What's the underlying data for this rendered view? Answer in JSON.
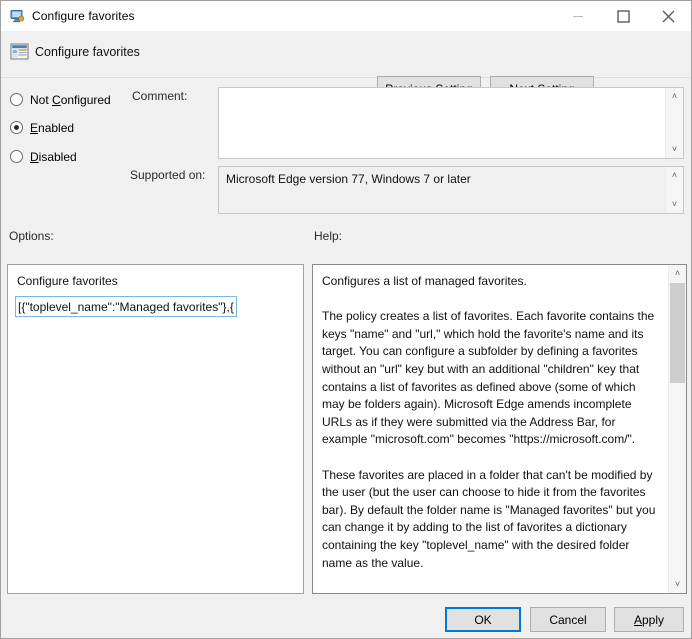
{
  "window": {
    "title": "Configure favorites",
    "icon": "policy-window-icon",
    "controls": {
      "minimize": "minimize-icon",
      "maximize": "maximize-icon",
      "close": "close-icon"
    }
  },
  "header": {
    "icon": "setting-properties-icon",
    "title": "Configure favorites",
    "previous_setting": "Previous Setting",
    "previous_setting_accel": "P",
    "next_setting": "Next Setting"
  },
  "state": {
    "options": [
      {
        "id": "not-configured",
        "label": "Not Configured",
        "accel": "C",
        "selected": false
      },
      {
        "id": "enabled",
        "label": "Enabled",
        "accel": "E",
        "selected": true
      },
      {
        "id": "disabled",
        "label": "Disabled",
        "accel": "D",
        "selected": false
      }
    ]
  },
  "comment": {
    "label": "Comment:",
    "value": "",
    "scroll_up": "˄",
    "scroll_down": "˅"
  },
  "supported": {
    "label": "Supported on:",
    "value": "Microsoft Edge version 77, Windows 7 or later",
    "scroll_up": "˄",
    "scroll_down": "˅"
  },
  "sections": {
    "options_label": "Options:",
    "help_label": "Help:"
  },
  "options_panel": {
    "field_label": "Configure favorites",
    "input_value": "[{\"toplevel_name\":\"Managed favorites\"},{\"r",
    "input_placeholder": ""
  },
  "help_panel": {
    "text": "Configures a list of managed favorites.\n\nThe policy creates a list of favorites. Each favorite contains the keys \"name\" and \"url,\" which hold the favorite's name and its target. You can configure a subfolder by defining a favorites without an \"url\" key but with an additional \"children\" key that contains a list of favorites as defined above (some of which may be folders again). Microsoft Edge amends incomplete URLs as if they were submitted via the Address Bar, for example \"microsoft.com\" becomes \"https://microsoft.com/\".\n\nThese favorites are placed in a folder that can't be modified by the user (but the user can choose to hide it from the favorites bar). By default the folder name is \"Managed favorites\" but you can change it by adding to the list of favorites a dictionary containing the key \"toplevel_name\" with the desired folder name as the value.\n\nManaged favorites are not synced to the user account and can't be modified by extensions.",
    "scroll_up": "˄",
    "scroll_down": "˅"
  },
  "footer": {
    "ok": "OK",
    "cancel": "Cancel",
    "apply": "Apply",
    "apply_accel": "A"
  },
  "colors": {
    "accent": "#0078d7",
    "dialog_bg": "#f0f0f0",
    "field_bg": "#ffffff",
    "border": "#a0a0a0"
  }
}
